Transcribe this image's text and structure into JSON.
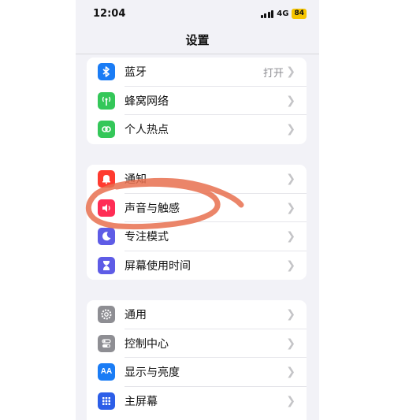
{
  "status": {
    "time": "12:04",
    "network": "4G",
    "battery": "84"
  },
  "nav": {
    "title": "设置"
  },
  "groups": [
    {
      "rows": [
        {
          "label": "蓝牙",
          "value": "打开",
          "icon": "bluetooth-icon",
          "color": "#1a7cf5"
        },
        {
          "label": "蜂窝网络",
          "value": "",
          "icon": "antenna-icon",
          "color": "#34c759"
        },
        {
          "label": "个人热点",
          "value": "",
          "icon": "hotspot-icon",
          "color": "#34c759"
        }
      ]
    },
    {
      "rows": [
        {
          "label": "通知",
          "value": "",
          "icon": "bell-icon",
          "color": "#ff3b30"
        },
        {
          "label": "声音与触感",
          "value": "",
          "icon": "speaker-icon",
          "color": "#ff2d55"
        },
        {
          "label": "专注模式",
          "value": "",
          "icon": "moon-icon",
          "color": "#5e5ce6"
        },
        {
          "label": "屏幕使用时间",
          "value": "",
          "icon": "hourglass-icon",
          "color": "#5e5ce6"
        }
      ]
    },
    {
      "rows": [
        {
          "label": "通用",
          "value": "",
          "icon": "gear-icon",
          "color": "#8e8e93"
        },
        {
          "label": "控制中心",
          "value": "",
          "icon": "toggles-icon",
          "color": "#8e8e93"
        },
        {
          "label": "显示与亮度",
          "value": "",
          "icon": "text-size-icon",
          "color": "#1a7cf5"
        },
        {
          "label": "主屏幕",
          "value": "",
          "icon": "home-grid-icon",
          "color": "#2c5ee8"
        }
      ]
    }
  ],
  "annotation": {
    "color": "#e8704f"
  }
}
